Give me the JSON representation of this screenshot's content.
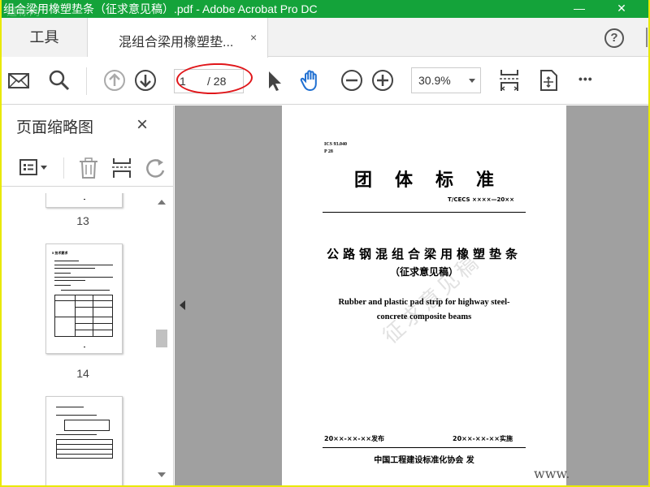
{
  "window": {
    "title": "组合梁用橡塑垫条（征求意见稿）.pdf - Adobe Acrobat Pro DC",
    "title_watermark": "道标网",
    "minimize": "—",
    "close": "✕"
  },
  "tabs": {
    "tools_label": "工具",
    "doc_label": "混组合梁用橡塑垫...",
    "doc_close": "×",
    "help": "?"
  },
  "toolbar": {
    "page_current": "1",
    "page_total": "/ 28",
    "zoom": "30.9%",
    "more": "•••"
  },
  "sidebar": {
    "title": "页面缩略图",
    "close": "×",
    "thumbnails": [
      {
        "num": "13"
      },
      {
        "num": "14",
        "heading": "5 技术要求"
      },
      {
        "num": ""
      }
    ]
  },
  "page": {
    "ics": "ICS 93.040",
    "p": "P 28",
    "standard_type": "团体标准",
    "code": "T/CECS ××××—20××",
    "title_cn": "公路钢混组合梁用橡塑垫条",
    "subtitle_cn": "（征求意见稿）",
    "title_en_1": "Rubber and plastic pad strip for highway steel-",
    "title_en_2": "concrete composite beams",
    "watermark": "征求意见稿",
    "publish": "20××-××-××发布",
    "implement": "20××-××-××实施",
    "organization": "中国工程建设标准化协会 发",
    "web_watermark": "www."
  }
}
